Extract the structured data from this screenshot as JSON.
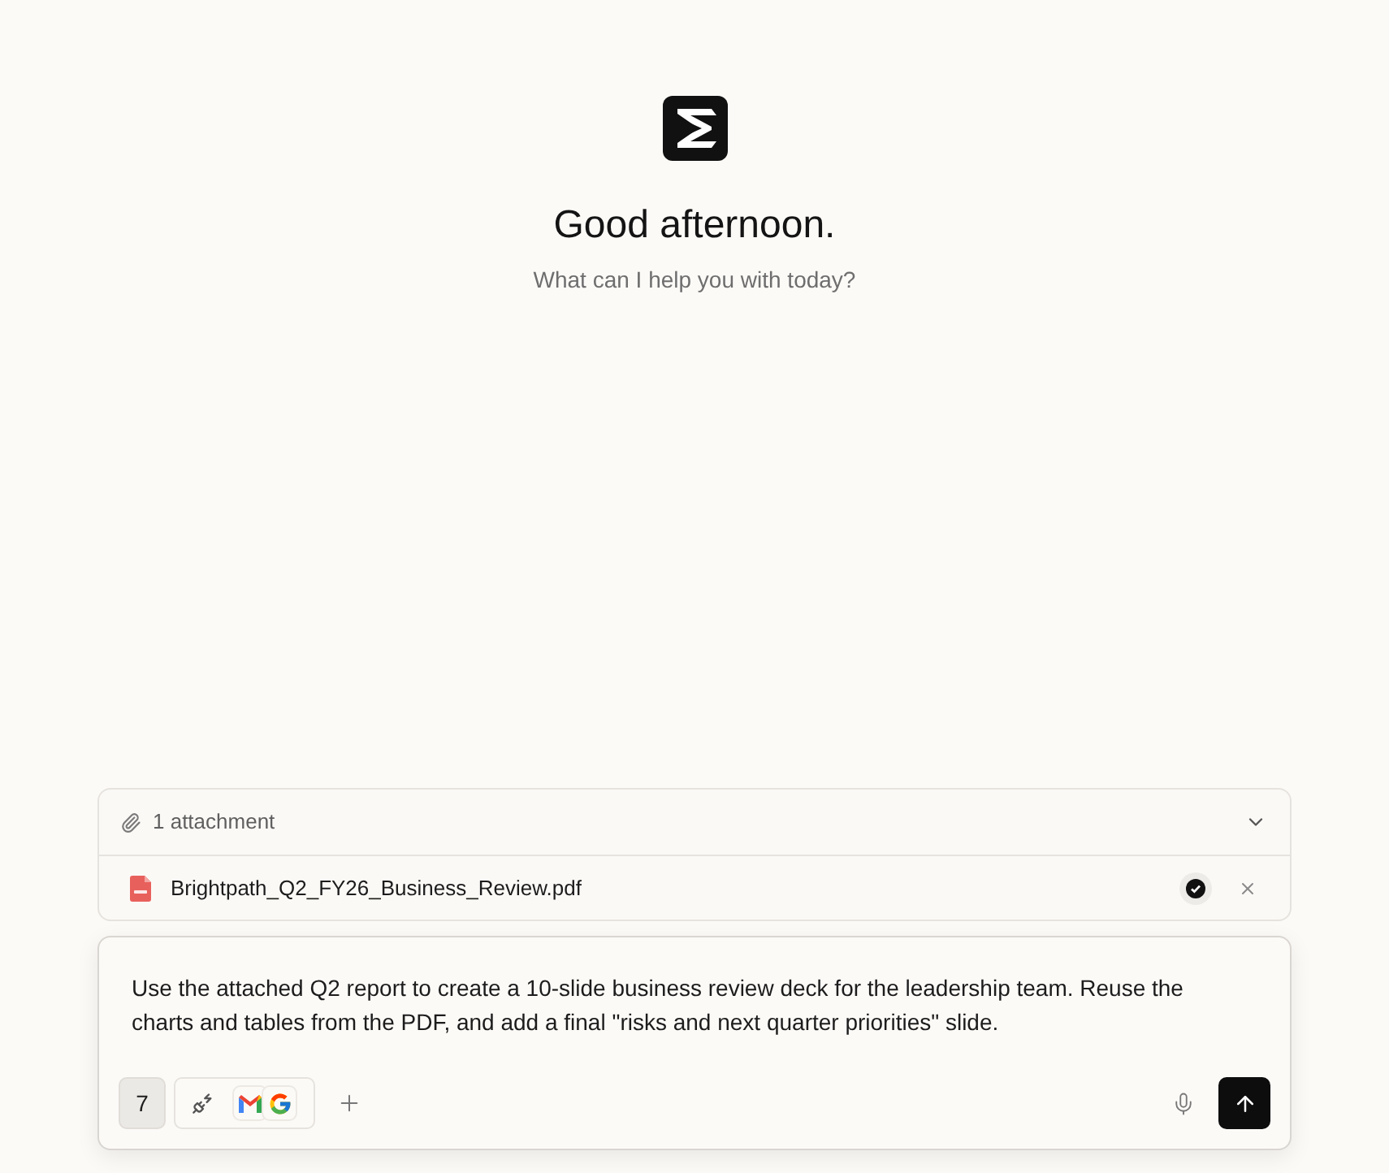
{
  "greeting": {
    "title": "Good afternoon.",
    "subtitle": "What can I help you with today?"
  },
  "attachments": {
    "summary": "1 attachment",
    "expanded": true,
    "files": [
      {
        "name": "Brightpath_Q2_FY26_Business_Review.pdf",
        "uploaded": true
      }
    ]
  },
  "composer": {
    "value": "Use the attached Q2 report to create a 10-slide business review deck for the leadership team. Reuse the charts and tables from the PDF, and add a final \"risks and next quarter priorities\" slide.",
    "number_button": "7"
  }
}
